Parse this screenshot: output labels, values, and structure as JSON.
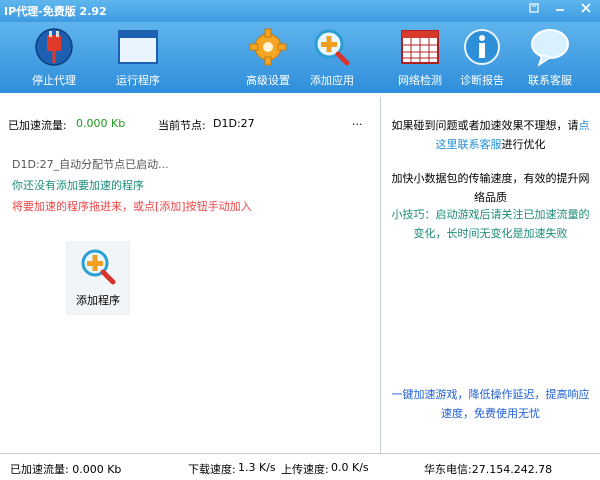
{
  "window": {
    "title": "IP代理-免费版 2.92",
    "controls": [
      "skin-icon",
      "minimize-icon",
      "close-icon"
    ]
  },
  "toolbar": {
    "stop_proxy": "停止代理",
    "run_program": "运行程序",
    "advanced_settings": "高级设置",
    "add_app": "添加应用",
    "network_check": "网络检测",
    "diagnostic_report": "诊断报告",
    "contact_support": "联系客服"
  },
  "main": {
    "accel_traffic_label": "已加速流量:",
    "accel_traffic_value": "0.000 Kb",
    "current_node_label": "当前节点:",
    "current_node_value": "D1D:27",
    "more": "...",
    "log": [
      "D1D:27_自动分配节点已启动...",
      "你还没有添加要加速的程序",
      "将要加速的程序拖进来，或点[添加]按钮手动加入"
    ],
    "add_program": "添加程序"
  },
  "sidebar": {
    "help_prefix": "如果碰到问题或者加速效果不理想，请",
    "help_link": "点这里联系客服",
    "help_suffix": "进行优化",
    "tip_main": "加快小数据包的传输速度，有效的提升网络品质",
    "tip_small": "小技巧：启动游戏后请关注已加速流量的变化，长时间无变化是加速失败",
    "slogan": "一键加速游戏，降低操作延迟，提高响应速度，免费使用无忧"
  },
  "statusbar": {
    "accel_traffic": "已加速流量: 0.000 Kb",
    "download_label": "下载速度:",
    "download_value": "1.3 K/s",
    "upload_label": "上传速度:",
    "upload_value": "0.0 K/s",
    "server": "华东电信:27.154.242.78"
  },
  "colors": {
    "toolbar_blue": "#3d9be0",
    "accent_green": "#1a9a1a",
    "warning_red": "#ee4444",
    "link_blue": "#1f8fd6"
  }
}
